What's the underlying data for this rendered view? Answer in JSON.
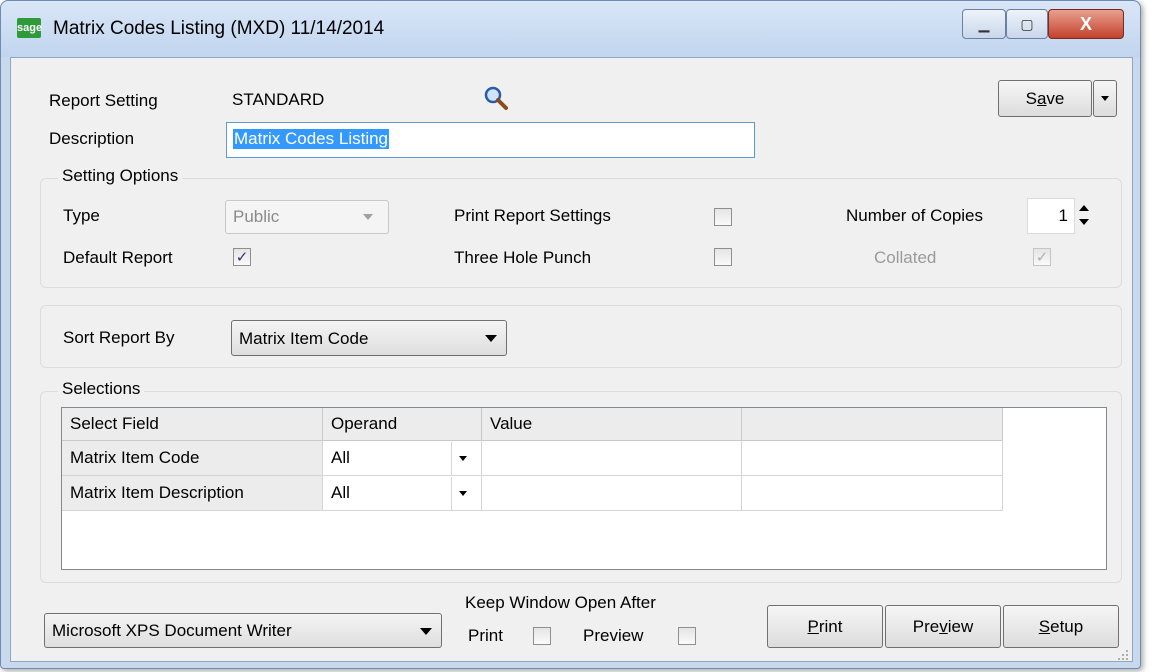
{
  "window": {
    "logo": "sage",
    "title": "Matrix Codes Listing (MXD) 11/14/2014",
    "minimize_glyph": "▁",
    "maximize_glyph": "▢",
    "close_glyph": "X"
  },
  "report_setting": {
    "label": "Report Setting",
    "value": "STANDARD",
    "lookup_icon": "magnifier-icon"
  },
  "description": {
    "label": "Description",
    "value": "Matrix Codes Listing"
  },
  "save": {
    "label_pre": "S",
    "label_ul": "a",
    "label_post": "ve"
  },
  "setting_options": {
    "title": "Setting Options",
    "type_label": "Type",
    "type_value": "Public",
    "default_report_label": "Default Report",
    "default_report_checked": true,
    "print_report_settings_label": "Print Report Settings",
    "print_report_settings_checked": false,
    "three_hole_punch_label": "Three Hole Punch",
    "three_hole_punch_checked": false,
    "number_of_copies_label": "Number of Copies",
    "number_of_copies_value": "1",
    "collated_label": "Collated",
    "collated_checked": true
  },
  "sort": {
    "label": "Sort Report By",
    "value": "Matrix Item Code"
  },
  "selections": {
    "title": "Selections",
    "columns": [
      "Select Field",
      "Operand",
      "Value",
      ""
    ],
    "rows": [
      {
        "field": "Matrix Item Code",
        "operand": "All",
        "value": "",
        "value2": ""
      },
      {
        "field": "Matrix Item Description",
        "operand": "All",
        "value": "",
        "value2": ""
      }
    ]
  },
  "printer": {
    "value": "Microsoft XPS Document Writer"
  },
  "keep_open": {
    "label": "Keep Window Open After",
    "print_label": "Print",
    "print_checked": false,
    "preview_label": "Preview",
    "preview_checked": false
  },
  "actions": {
    "print_ul": "P",
    "print_rest": "rint",
    "preview_pre": "Pre",
    "preview_ul": "v",
    "preview_post": "iew",
    "setup_ul": "S",
    "setup_rest": "etup"
  },
  "colors": {
    "title_bar": "#c1d5ef",
    "client_bg": "#f0f0f0",
    "selection_highlight": "#3399ff",
    "close_button": "#c3412c"
  }
}
